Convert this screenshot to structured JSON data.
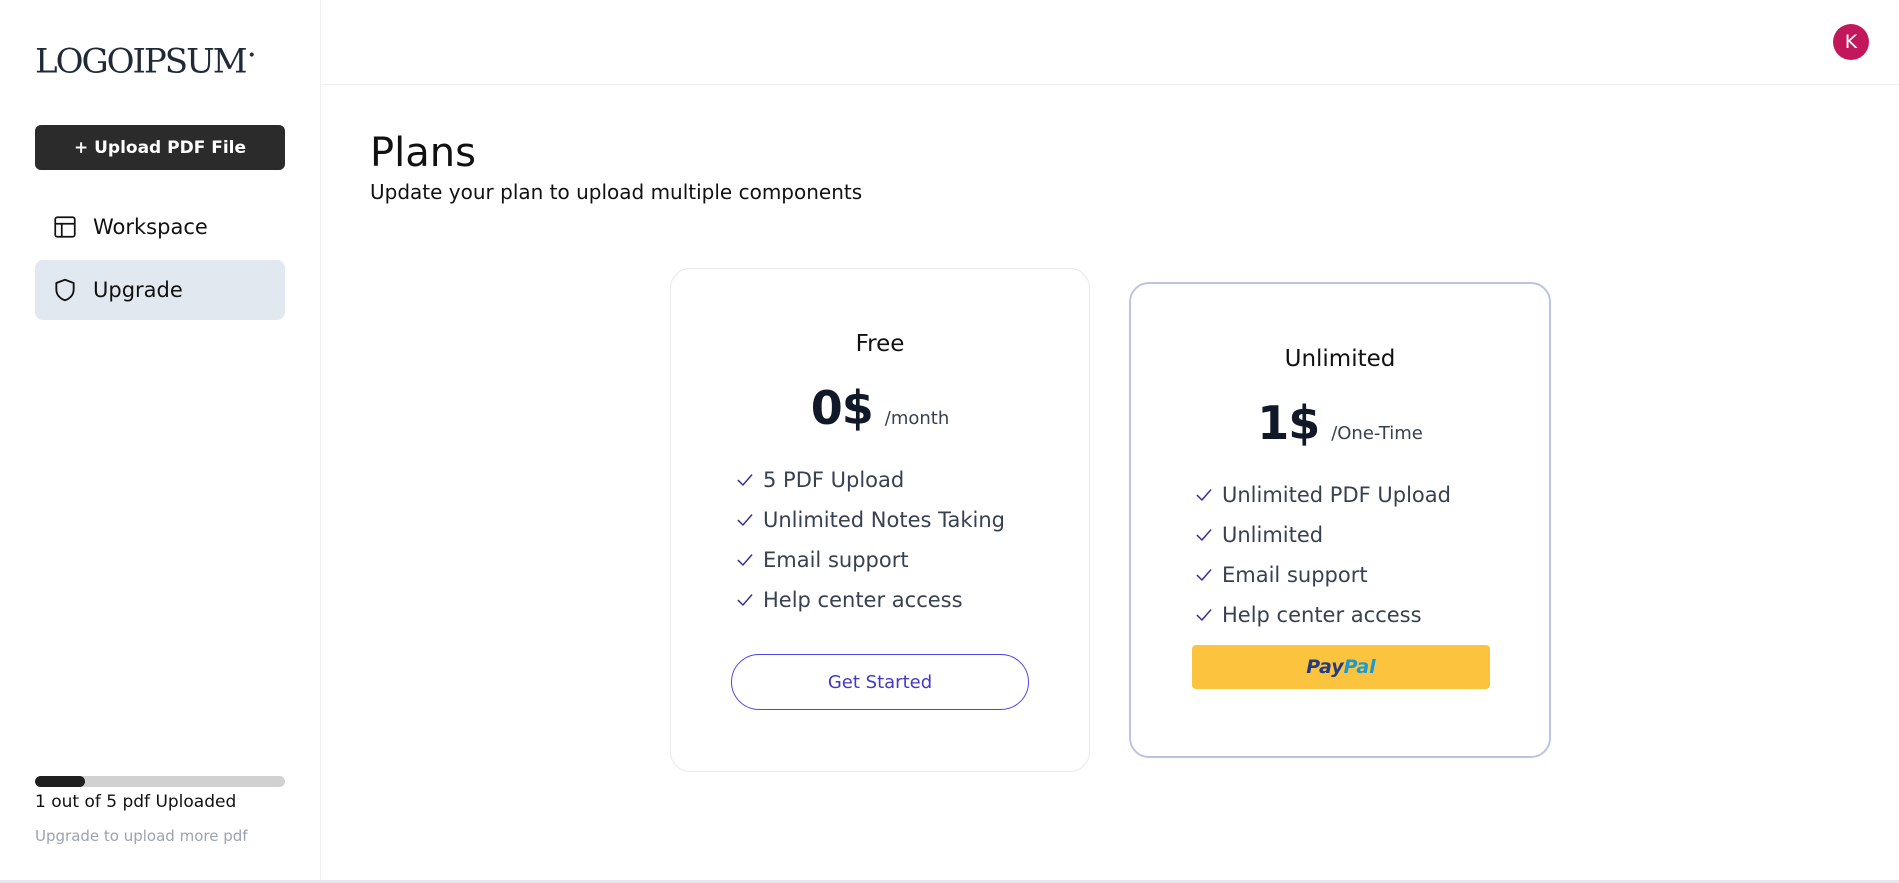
{
  "brand": {
    "logo_text": "LOGOIPSUM"
  },
  "sidebar": {
    "upload_button": "+ Upload PDF File",
    "items": [
      {
        "label": "Workspace",
        "icon": "layout-icon",
        "active": false
      },
      {
        "label": "Upgrade",
        "icon": "shield-icon",
        "active": true
      }
    ],
    "usage": {
      "progress": 0.2,
      "text": "1 out of 5 pdf Uploaded",
      "hint": "Upgrade to upload more pdf"
    }
  },
  "header": {
    "avatar_initial": "K"
  },
  "main": {
    "title": "Plans",
    "subtitle": "Update your plan to upload multiple components",
    "plans": [
      {
        "name": "Free",
        "price": "0$",
        "period": "/month",
        "features": [
          "5 PDF Upload",
          "Unlimited Notes Taking",
          "Email support",
          "Help center access"
        ],
        "cta": "Get Started"
      },
      {
        "name": "Unlimited",
        "price": "1$",
        "period": "/One-Time",
        "features": [
          "Unlimited PDF Upload",
          "Unlimited",
          "Email support",
          "Help center access"
        ],
        "cta_part1": "Pay",
        "cta_part2": "Pal"
      }
    ]
  },
  "colors": {
    "accent": "#4f46e5",
    "avatar": "#c2185b",
    "paypal_button": "#fcc43e",
    "active_nav": "#e2e8f0"
  }
}
